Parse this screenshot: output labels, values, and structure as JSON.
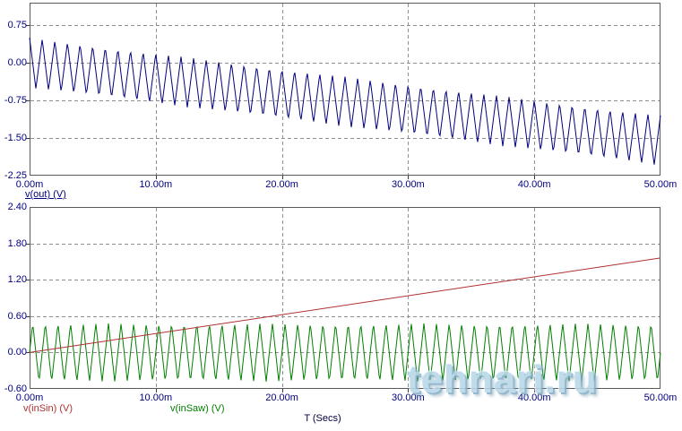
{
  "watermark": {
    "text": "tehnari.ru",
    "color": "#b7d7e8"
  },
  "style_colors": {
    "axis_text": "#000080",
    "grid_line": "#909090",
    "plot_border": "#5a5a5a",
    "tick_mark": "#3a3a3a",
    "x_title_text": "#000040",
    "background": "#ffffff"
  },
  "chart_data": [
    {
      "type": "line",
      "title": "",
      "grid": "dashed",
      "x_axis": {
        "range_ms": [
          0,
          50
        ],
        "ticks": [
          {
            "label": "0.00m",
            "t_ms": 0
          },
          {
            "label": "10.00m",
            "t_ms": 10
          },
          {
            "label": "20.00m",
            "t_ms": 20
          },
          {
            "label": "30.00m",
            "t_ms": 30
          },
          {
            "label": "40.00m",
            "t_ms": 40
          },
          {
            "label": "50.00m",
            "t_ms": 50
          }
        ]
      },
      "y_axis": {
        "range_v": [
          -2.25,
          1.2
        ],
        "ticks": [
          {
            "label": "0.75",
            "v": 0.75
          },
          {
            "label": "0.00",
            "v": 0.0
          },
          {
            "label": "-0.75",
            "v": -0.75
          },
          {
            "label": "-1.50",
            "v": -1.5
          },
          {
            "label": "-2.25",
            "v": -2.25
          }
        ]
      },
      "series": [
        {
          "name": "v(out) (V)",
          "color": "#000080",
          "waveform": "triangle",
          "frequency_hz": 1000,
          "amplitude_v": 0.5,
          "phase_at_t0": "peak",
          "baseline": {
            "start_v": 0.0,
            "slope_v_per_ms": -0.031
          },
          "underlined_legend": true,
          "description": "1 kHz triangle wave (about ±0.5 V) whose mean drifts linearly from ~0 V at 0 ms to ~-1.55 V at 50 ms; starts on a +0.5 V peak, ends on a ~-1.05 V peak"
        }
      ]
    },
    {
      "type": "line",
      "title": "",
      "grid": "dashed",
      "x_axis": {
        "title": "T (Secs)",
        "range_ms": [
          0,
          50
        ],
        "ticks": [
          {
            "label": "0.00m",
            "t_ms": 0
          },
          {
            "label": "10.00m",
            "t_ms": 10
          },
          {
            "label": "20.00m",
            "t_ms": 20
          },
          {
            "label": "30.00m",
            "t_ms": 30
          },
          {
            "label": "40.00m",
            "t_ms": 40
          },
          {
            "label": "50.00m",
            "t_ms": 50
          }
        ]
      },
      "y_axis": {
        "range_v": [
          -0.6,
          2.4
        ],
        "ticks": [
          {
            "label": "2.40",
            "v": 2.4
          },
          {
            "label": "1.80",
            "v": 1.8
          },
          {
            "label": "1.20",
            "v": 1.2
          },
          {
            "label": "0.60",
            "v": 0.6
          },
          {
            "label": "0.00",
            "v": 0.0
          },
          {
            "label": "-0.60",
            "v": -0.6
          }
        ]
      },
      "series": [
        {
          "name": "v(inSin) (V)",
          "color": "#b03030",
          "waveform": "ramp",
          "start_v": 0.0,
          "end_v": 1.56,
          "description": "near-linear ramp from 0.00 V at 0 ms to ~1.56 V at 50 ms (crosses 0.60 V near 20 ms)"
        },
        {
          "name": "v(inSaw) (V)",
          "color": "#008000",
          "waveform": "triangle",
          "frequency_hz": 1000,
          "amplitude_v": 0.48,
          "phase_at_t0": "zero-rising",
          "baseline": {
            "start_v": 0.0,
            "slope_v_per_ms": 0
          },
          "description": "1 kHz triangle wave, ±0.48 V centred on 0 V, starting at 0 V rising"
        }
      ]
    }
  ]
}
